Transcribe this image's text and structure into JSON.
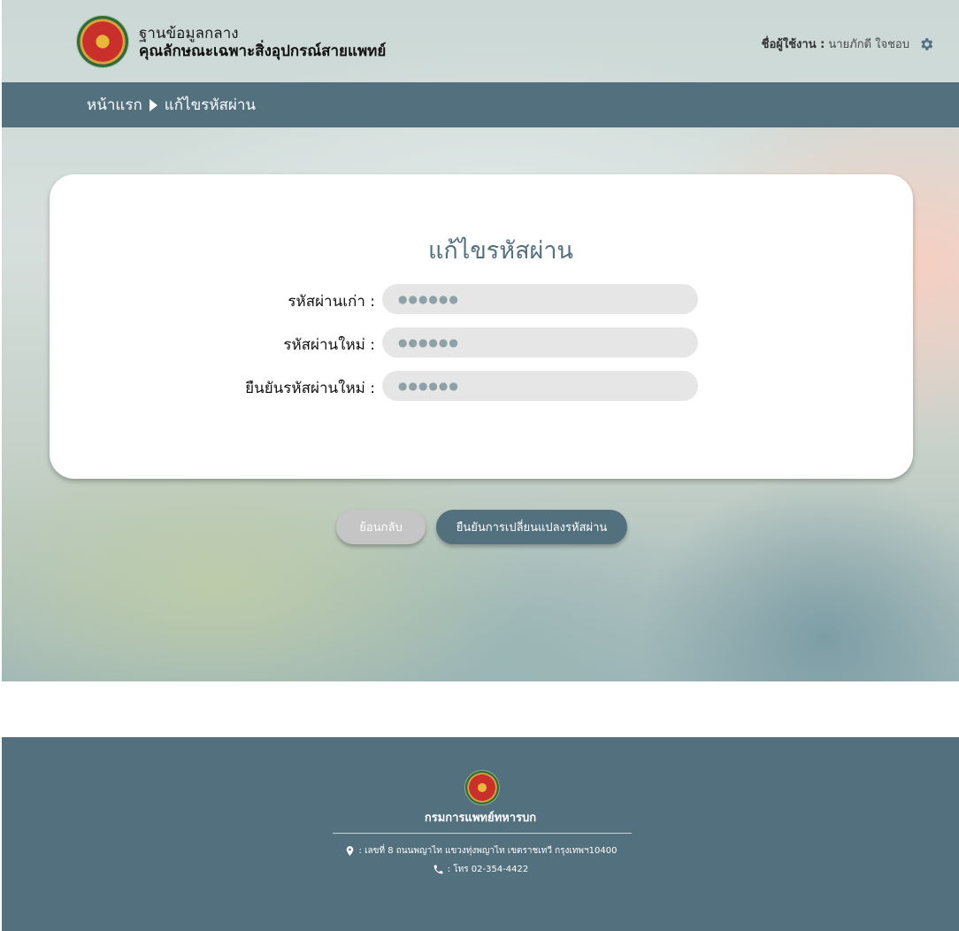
{
  "header": {
    "site_line1": "ฐานข้อมูลกลาง",
    "site_line2": "คุณลักษณะเฉพาะสิ่งอุปกรณ์สายแพทย์",
    "user_label": "ชื่อผู้ใช้งาน :",
    "user_name": "นายภักดี ใจชอบ",
    "settings_icon": "gear-icon"
  },
  "breadcrumb": {
    "home": "หน้าแรก",
    "current": "แก้ไขรหัสผ่าน"
  },
  "form": {
    "title": "แก้ไขรหัสผ่าน",
    "old_password_label": "รหัสผ่านเก่า :",
    "old_password_value": "●●●●●●",
    "new_password_label": "รหัสผ่านใหม่ :",
    "new_password_value": "●●●●●●",
    "confirm_password_label": "ยืนยันรหัสผ่านใหม่ :",
    "confirm_password_value": "●●●●●●"
  },
  "actions": {
    "back_label": "ย้อนกลับ",
    "confirm_label": "ยืนยันการเปลี่ยนแปลงรหัสผ่าน"
  },
  "footer": {
    "org_name": "กรมการแพทย์ทหารบก",
    "address": ": เลขที่ 8 ถนนพญาไท แขวงทุ่งพญาไท เขตราชเทวี กรุงเทพฯ10400",
    "phone": ": โทร 02-354-4422"
  },
  "colors": {
    "primary": "#53707f",
    "button_disabled": "#c5c5c5",
    "field_bg": "#e6e6e6"
  }
}
